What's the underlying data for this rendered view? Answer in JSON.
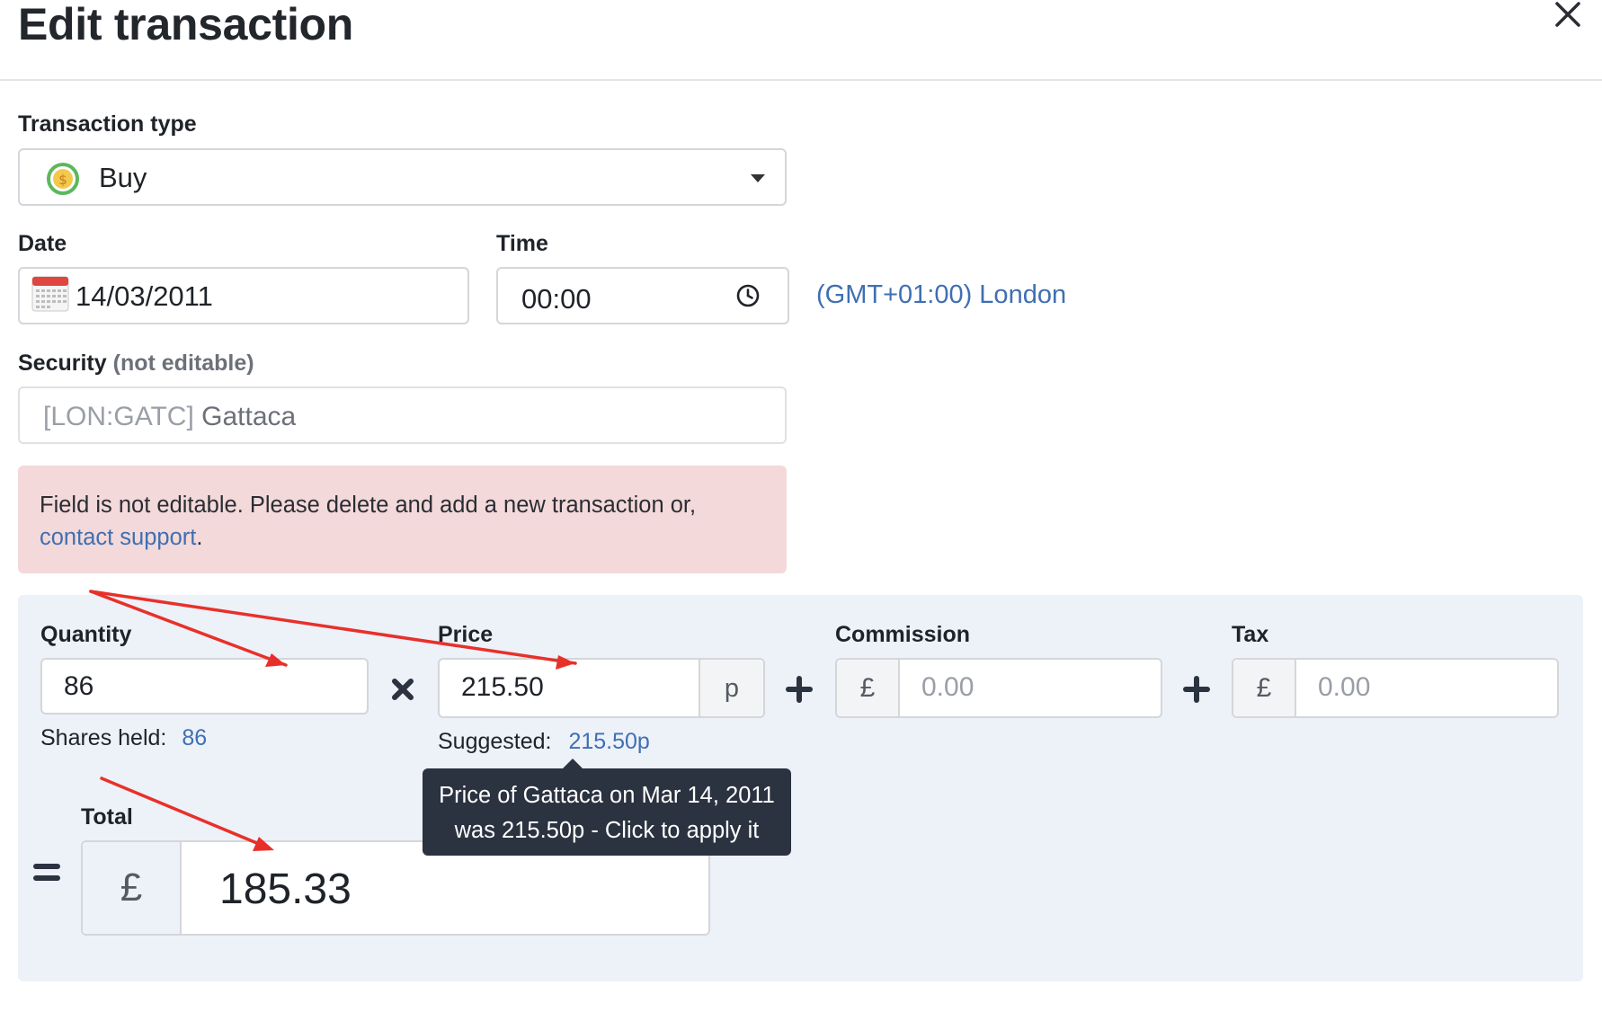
{
  "dialog": {
    "title": "Edit transaction",
    "close_icon": "close-icon"
  },
  "transaction_type": {
    "label": "Transaction type",
    "value": "Buy",
    "icon": "buy-coin-icon"
  },
  "date": {
    "label": "Date",
    "value": "14/03/2011",
    "icon": "calendar-icon"
  },
  "time": {
    "label": "Time",
    "value": "00:00",
    "icon": "clock-icon"
  },
  "timezone": {
    "text": "(GMT+01:00) London"
  },
  "security": {
    "label": "Security",
    "label_suffix": "(not editable)",
    "ticker": "[LON:GATC]",
    "name": "Gattaca"
  },
  "alert": {
    "text": "Field is not editable. Please delete and add a new transaction or, ",
    "link": "contact support",
    "end": "."
  },
  "quantity": {
    "label": "Quantity",
    "value": "86",
    "held_label": "Shares held:",
    "held_value": "86"
  },
  "price": {
    "label": "Price",
    "value": "215.50",
    "unit": "p",
    "suggested_label": "Suggested:",
    "suggested_value": "215.50p"
  },
  "commission": {
    "label": "Commission",
    "currency": "£",
    "placeholder": "0.00"
  },
  "tax": {
    "label": "Tax",
    "currency": "£",
    "placeholder": "0.00"
  },
  "total": {
    "label": "Total",
    "currency": "£",
    "value": "185.33"
  },
  "tooltip": {
    "line1": "Price of Gattaca on Mar 14, 2011",
    "line2": "was 215.50p - Click to apply it"
  },
  "colors": {
    "link": "#3f6fb2",
    "alert_bg": "#f3d9da",
    "panel_bg": "#edf1f8",
    "tooltip_bg": "#2b3240",
    "annotation": "#e8302a"
  }
}
